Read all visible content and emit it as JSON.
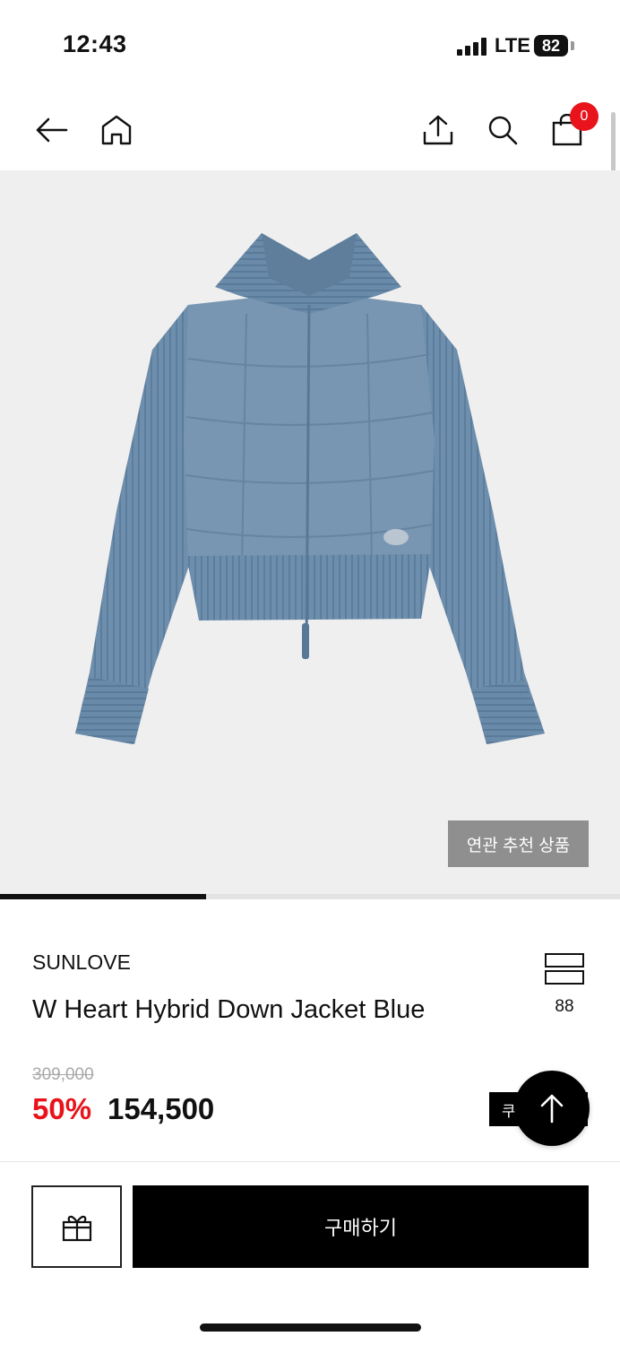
{
  "status_bar": {
    "time": "12:43",
    "network": "LTE",
    "battery": "82"
  },
  "nav": {
    "icons": [
      "back-arrow-icon",
      "home-icon",
      "share-icon",
      "search-icon",
      "shopping-bag-icon"
    ],
    "cart_count": "0"
  },
  "hero": {
    "image_subject": "blue-hybrid-down-jacket",
    "related_button_label": "연관 추천 상품",
    "gallery_progress_fraction": 0.333
  },
  "product": {
    "brand": "SUNLOVE",
    "name": "W Heart Hybrid Down Jacket Blue",
    "bookmark_count": "88",
    "original_price": "309,000",
    "discount_rate": "50%",
    "sale_price": "154,500",
    "coupon_label": "쿠폰"
  },
  "actions": {
    "buy_label": "구매하기",
    "gift_icon": "gift-icon",
    "scroll_top_icon": "arrow-up-icon"
  },
  "colors": {
    "accent_red": "#e8131b",
    "jacket_blue": "#6d8ead",
    "hero_background": "#efefef",
    "button_black": "#000000"
  }
}
